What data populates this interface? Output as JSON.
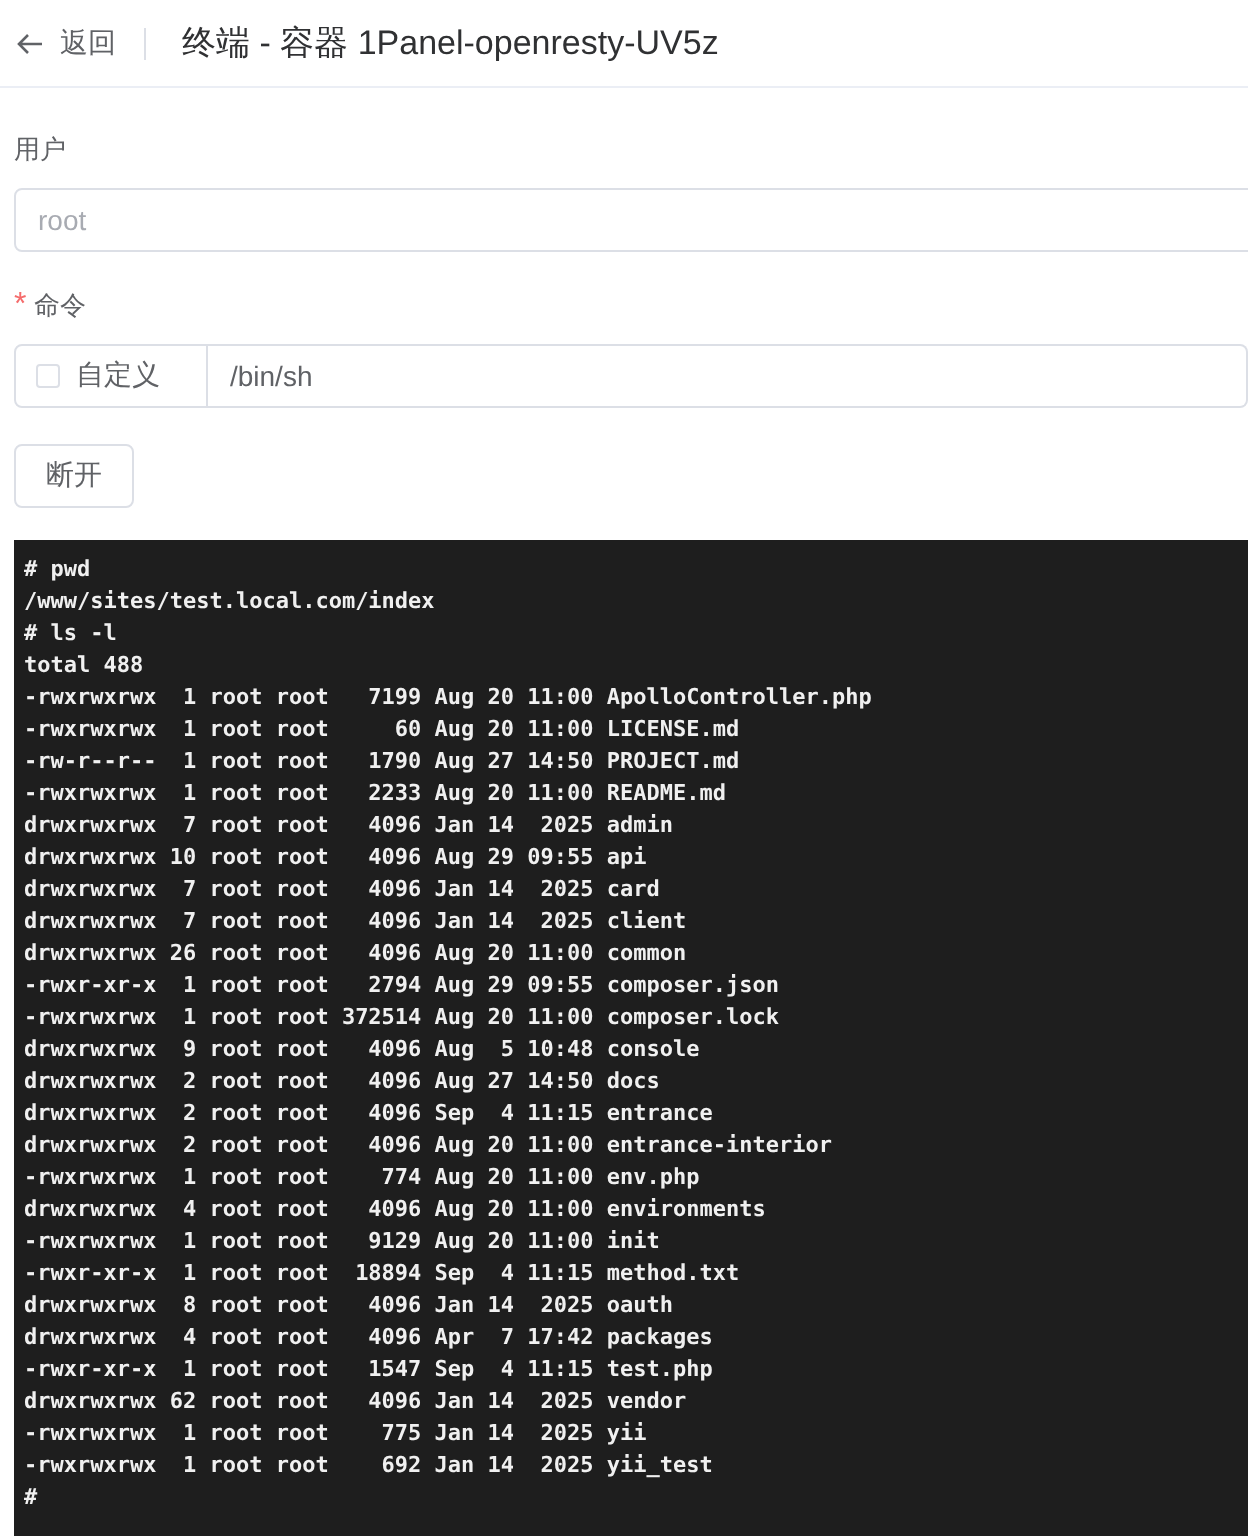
{
  "header": {
    "back_label": "返回",
    "title": "终端 - 容器 1Panel-openresty-UV5z"
  },
  "user": {
    "label": "用户",
    "placeholder": "root"
  },
  "command": {
    "label": "命令",
    "required_mark": "*",
    "custom": {
      "label": "自定义",
      "checked": false
    },
    "value": "/bin/sh"
  },
  "buttons": [
    "断开"
  ],
  "terminal": {
    "lines": [
      "# pwd",
      "/www/sites/test.local.com/index",
      "# ls -l",
      "total 488",
      "-rwxrwxrwx  1 root root   7199 Aug 20 11:00 ApolloController.php",
      "-rwxrwxrwx  1 root root     60 Aug 20 11:00 LICENSE.md",
      "-rw-r--r--  1 root root   1790 Aug 27 14:50 PROJECT.md",
      "-rwxrwxrwx  1 root root   2233 Aug 20 11:00 README.md",
      "drwxrwxrwx  7 root root   4096 Jan 14  2025 admin",
      "drwxrwxrwx 10 root root   4096 Aug 29 09:55 api",
      "drwxrwxrwx  7 root root   4096 Jan 14  2025 card",
      "drwxrwxrwx  7 root root   4096 Jan 14  2025 client",
      "drwxrwxrwx 26 root root   4096 Aug 20 11:00 common",
      "-rwxr-xr-x  1 root root   2794 Aug 29 09:55 composer.json",
      "-rwxrwxrwx  1 root root 372514 Aug 20 11:00 composer.lock",
      "drwxrwxrwx  9 root root   4096 Aug  5 10:48 console",
      "drwxrwxrwx  2 root root   4096 Aug 27 14:50 docs",
      "drwxrwxrwx  2 root root   4096 Sep  4 11:15 entrance",
      "drwxrwxrwx  2 root root   4096 Aug 20 11:00 entrance-interior",
      "-rwxrwxrwx  1 root root    774 Aug 20 11:00 env.php",
      "drwxrwxrwx  4 root root   4096 Aug 20 11:00 environments",
      "-rwxrwxrwx  1 root root   9129 Aug 20 11:00 init",
      "-rwxr-xr-x  1 root root  18894 Sep  4 11:15 method.txt",
      "drwxrwxrwx  8 root root   4096 Jan 14  2025 oauth",
      "drwxrwxrwx  4 root root   4096 Apr  7 17:42 packages",
      "-rwxr-xr-x  1 root root   1547 Sep  4 11:15 test.php",
      "drwxrwxrwx 62 root root   4096 Jan 14  2025 vendor",
      "-rwxrwxrwx  1 root root    775 Jan 14  2025 yii",
      "-rwxrwxrwx  1 root root    692 Jan 14  2025 yii_test",
      "#"
    ]
  }
}
